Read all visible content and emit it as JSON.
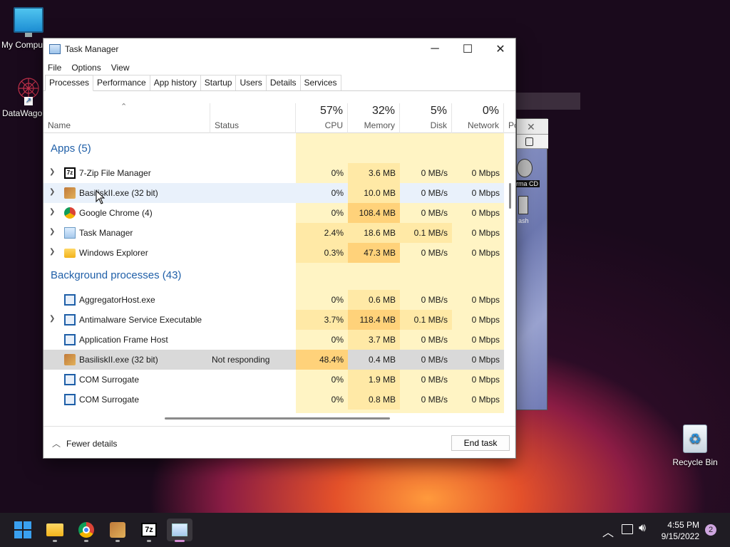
{
  "desktop": {
    "icons": [
      {
        "label": "My Computer"
      },
      {
        "label": "DataWagon"
      },
      {
        "label": "Recycle Bin"
      }
    ]
  },
  "window": {
    "title": "Task Manager",
    "menu": [
      "File",
      "Options",
      "View"
    ],
    "tabs": [
      "Processes",
      "Performance",
      "App history",
      "Startup",
      "Users",
      "Details",
      "Services"
    ],
    "active_tab": "Processes"
  },
  "columns": {
    "name": "Name",
    "status": "Status",
    "cpu": {
      "pct": "57%",
      "label": "CPU"
    },
    "memory": {
      "pct": "32%",
      "label": "Memory"
    },
    "disk": {
      "pct": "5%",
      "label": "Disk"
    },
    "network": {
      "pct": "0%",
      "label": "Network"
    },
    "power": "Po"
  },
  "groups": {
    "apps": "Apps (5)",
    "background": "Background processes (43)"
  },
  "apps": [
    {
      "name": "7-Zip File Manager",
      "status": "",
      "cpu": "0%",
      "mem": "3.6 MB",
      "disk": "0 MB/s",
      "net": "0 Mbps",
      "icon": "7zip-icon"
    },
    {
      "name": "BasiliskII.exe (32 bit)",
      "status": "",
      "cpu": "0%",
      "mem": "10.0 MB",
      "disk": "0 MB/s",
      "net": "0 Mbps",
      "icon": "basilisk-icon"
    },
    {
      "name": "Google Chrome (4)",
      "status": "",
      "cpu": "0%",
      "mem": "108.4 MB",
      "disk": "0 MB/s",
      "net": "0 Mbps",
      "icon": "chrome-icon"
    },
    {
      "name": "Task Manager",
      "status": "",
      "cpu": "2.4%",
      "mem": "18.6 MB",
      "disk": "0.1 MB/s",
      "net": "0 Mbps",
      "icon": "taskmgr-icon"
    },
    {
      "name": "Windows Explorer",
      "status": "",
      "cpu": "0.3%",
      "mem": "47.3 MB",
      "disk": "0 MB/s",
      "net": "0 Mbps",
      "icon": "folder-icon"
    }
  ],
  "background": [
    {
      "name": "AggregatorHost.exe",
      "status": "",
      "cpu": "0%",
      "mem": "0.6 MB",
      "disk": "0 MB/s",
      "net": "0 Mbps"
    },
    {
      "name": "Antimalware Service Executable",
      "status": "",
      "cpu": "3.7%",
      "mem": "118.4 MB",
      "disk": "0.1 MB/s",
      "net": "0 Mbps"
    },
    {
      "name": "Application Frame Host",
      "status": "",
      "cpu": "0%",
      "mem": "3.7 MB",
      "disk": "0 MB/s",
      "net": "0 Mbps"
    },
    {
      "name": "BasiliskII.exe (32 bit)",
      "status": "Not responding",
      "cpu": "48.4%",
      "mem": "0.4 MB",
      "disk": "0 MB/s",
      "net": "0 Mbps"
    },
    {
      "name": "COM Surrogate",
      "status": "",
      "cpu": "0%",
      "mem": "1.9 MB",
      "disk": "0 MB/s",
      "net": "0 Mbps"
    },
    {
      "name": "COM Surrogate",
      "status": "",
      "cpu": "0%",
      "mem": "0.8 MB",
      "disk": "0 MB/s",
      "net": "0 Mbps"
    }
  ],
  "footer": {
    "fewer": "Fewer details",
    "end_task": "End task"
  },
  "emulator": {
    "cd_label": "rma CD",
    "trash_label": "ash"
  },
  "taskbar": {
    "time": "4:55 PM",
    "date": "9/15/2022",
    "notifications": "2"
  },
  "colors": {
    "heat_light": "#fff4c4",
    "heat_mid": "#ffe9a6",
    "heat_high": "#ffd27a",
    "group_text": "#1f5fa8"
  }
}
